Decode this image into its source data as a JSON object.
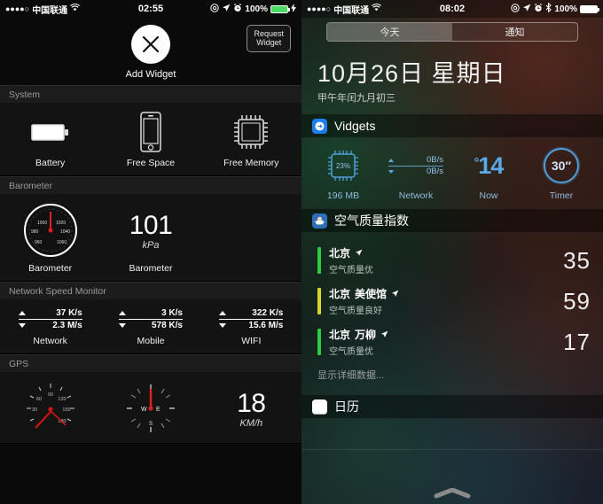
{
  "left": {
    "status": {
      "signal_dots": "●●●●○",
      "carrier": "中国联通",
      "wifi_icon": "wifi-icon",
      "time": "02:55",
      "dnd_icon": "do-not-disturb-icon",
      "location_icon": "location-arrow-icon",
      "alarm_icon": "alarm-clock-icon",
      "battery_percent": "100%",
      "battery_state": "charging"
    },
    "add_widget": {
      "button_icon": "close-x-icon",
      "label": "Add Widget",
      "request_line1": "Request",
      "request_line2": "Widget"
    },
    "sections": [
      {
        "title": "System",
        "cells": [
          {
            "icon": "battery-icon",
            "label": "Battery"
          },
          {
            "icon": "phone-icon",
            "label": "Free Space"
          },
          {
            "icon": "memory-chip-icon",
            "label": "Free Memory"
          }
        ]
      },
      {
        "title": "Barometer",
        "cells": [
          {
            "icon": "barometer-gauge-icon",
            "label": "Barometer"
          },
          {
            "value": "101",
            "unit": "kPa",
            "label": "Barometer"
          }
        ],
        "gauge_ticks": [
          "980",
          "1000",
          "1020",
          "1040",
          "1060"
        ]
      },
      {
        "title": "Network Speed Monitor",
        "cells": [
          {
            "up": "37 K/s",
            "down": "2.3 M/s",
            "label": "Network"
          },
          {
            "up": "3 K/s",
            "down": "578 K/s",
            "label": "Mobile"
          },
          {
            "up": "322 K/s",
            "down": "15.6 M/s",
            "label": "WIFI"
          }
        ]
      },
      {
        "title": "GPS",
        "cells": [
          {
            "icon": "speedometer-icon",
            "ticks": [
              "30",
              "60",
              "90",
              "120",
              "150",
              "180"
            ]
          },
          {
            "icon": "compass-icon",
            "marks": [
              "W",
              "E",
              "S"
            ]
          },
          {
            "value": "18",
            "unit": "KM/h"
          }
        ]
      }
    ]
  },
  "right": {
    "status": {
      "signal_dots": "●●●●○",
      "carrier": "中国联通",
      "wifi_icon": "wifi-icon",
      "time": "08:02",
      "dnd_icon": "do-not-disturb-icon",
      "location_icon": "location-arrow-icon",
      "alarm_icon": "alarm-clock-icon",
      "bluetooth_icon": "bluetooth-icon",
      "battery_percent": "100%",
      "battery_state": "full"
    },
    "tabs": [
      {
        "label": "今天",
        "selected": true
      },
      {
        "label": "通知",
        "selected": false
      }
    ],
    "date": {
      "main": "10月26日 星期日",
      "lunar": "甲午年闰九月初三"
    },
    "widgets_group": {
      "icon": "vidgets-app-icon",
      "title": "Vidgets",
      "items": [
        {
          "type": "chip",
          "value": "23%",
          "label": "196 MB"
        },
        {
          "type": "network",
          "up": "0B/s",
          "down": "0B/s",
          "label": "Network"
        },
        {
          "type": "temp",
          "degree": "°",
          "value": "14",
          "label": "Now"
        },
        {
          "type": "timer",
          "value": "30″",
          "label": "Timer"
        }
      ]
    },
    "aqi_group": {
      "icon": "face-mask-icon",
      "title": "空气质量指数",
      "items": [
        {
          "city": "北京",
          "station": "",
          "desc": "空气质量优",
          "value": "35",
          "color": "#2ecc40",
          "location_icon": "location-arrow-icon"
        },
        {
          "city": "北京",
          "station": "美使馆",
          "desc": "空气质量良好",
          "value": "59",
          "color": "#d8d432",
          "location_icon": "location-arrow-icon"
        },
        {
          "city": "北京",
          "station": "万柳",
          "desc": "空气质量优",
          "value": "17",
          "color": "#2ecc40",
          "location_icon": "location-arrow-icon"
        }
      ],
      "more_label": "显示详细数据..."
    },
    "calendar_group": {
      "icon": "calendar-app-icon",
      "title": "日历"
    },
    "grabber_icon": "grabber-handle-icon"
  }
}
